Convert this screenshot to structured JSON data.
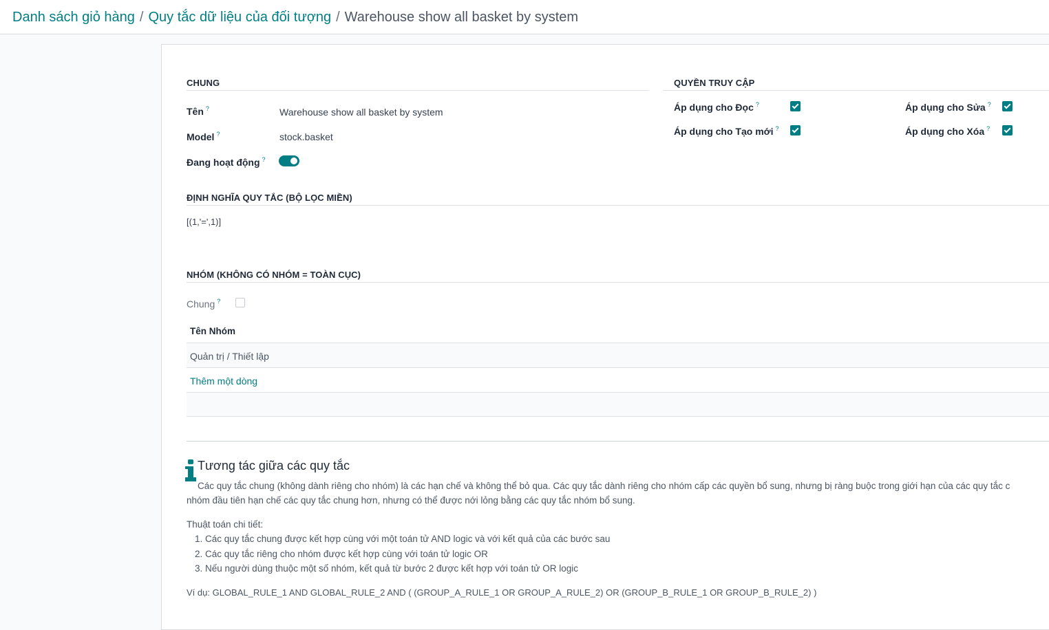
{
  "breadcrumb": {
    "items": [
      "Danh sách giỏ hàng",
      "Quy tắc dữ liệu của đối tượng"
    ],
    "current": "Warehouse show all basket by system",
    "separator": "/"
  },
  "general": {
    "title": "CHUNG",
    "name_label": "Tên",
    "name_value": "Warehouse show all basket by system",
    "model_label": "Model",
    "model_value": "stock.basket",
    "active_label": "Đang hoạt động",
    "active": true
  },
  "access": {
    "title": "QUYỀN TRUY CẬP",
    "read_label": "Áp dụng cho Đọc",
    "read": true,
    "write_label": "Áp dụng cho Sửa",
    "write": true,
    "create_label": "Áp dụng cho Tạo mới",
    "create": true,
    "delete_label": "Áp dụng cho Xóa",
    "delete": true
  },
  "rule_definition": {
    "title": "ĐỊNH NGHĨA QUY TẮC (BỘ LỌC MIỀN)",
    "domain": "[(1,'=',1)]"
  },
  "groups": {
    "title": "NHÓM (KHÔNG CÓ NHÓM = TOÀN CỤC)",
    "global_label": "Chung",
    "global": false,
    "column_header": "Tên Nhóm",
    "rows": [
      "Quản trị / Thiết lập"
    ],
    "add_line": "Thêm một dòng"
  },
  "help": {
    "title": "Tương tác giữa các quy tắc",
    "paragraph_line1": "Các quy tắc chung (không dành riêng cho nhóm) là các hạn chế và không thể bỏ qua. Các quy tắc dành riêng cho nhóm cấp các quyền bổ sung, nhưng bị ràng buộc trong giới hạn của các quy tắc c",
    "paragraph_line2": "nhóm đầu tiên hạn chế các quy tắc chung hơn, nhưng có thể được nới lỏng bằng các quy tắc nhóm bổ sung.",
    "algorithm_title": "Thuật toán chi tiết:",
    "steps": [
      "1. Các quy tắc chung được kết hợp cùng với một toán tử AND logic và với kết quả của các bước sau",
      "2. Các quy tắc riêng cho nhóm được kết hợp cùng với toán tử logic OR",
      "3. Nếu người dùng thuộc một số nhóm, kết quả từ bước 2 được kết hợp với toán tử OR logic"
    ],
    "example": "Ví dụ: GLOBAL_RULE_1 AND GLOBAL_RULE_2 AND ( (GROUP_A_RULE_1 OR GROUP_A_RULE_2) OR (GROUP_B_RULE_1 OR GROUP_B_RULE_2) )"
  },
  "colors": {
    "accent": "#017e84",
    "heading": "#1f2937",
    "text": "#374151"
  }
}
